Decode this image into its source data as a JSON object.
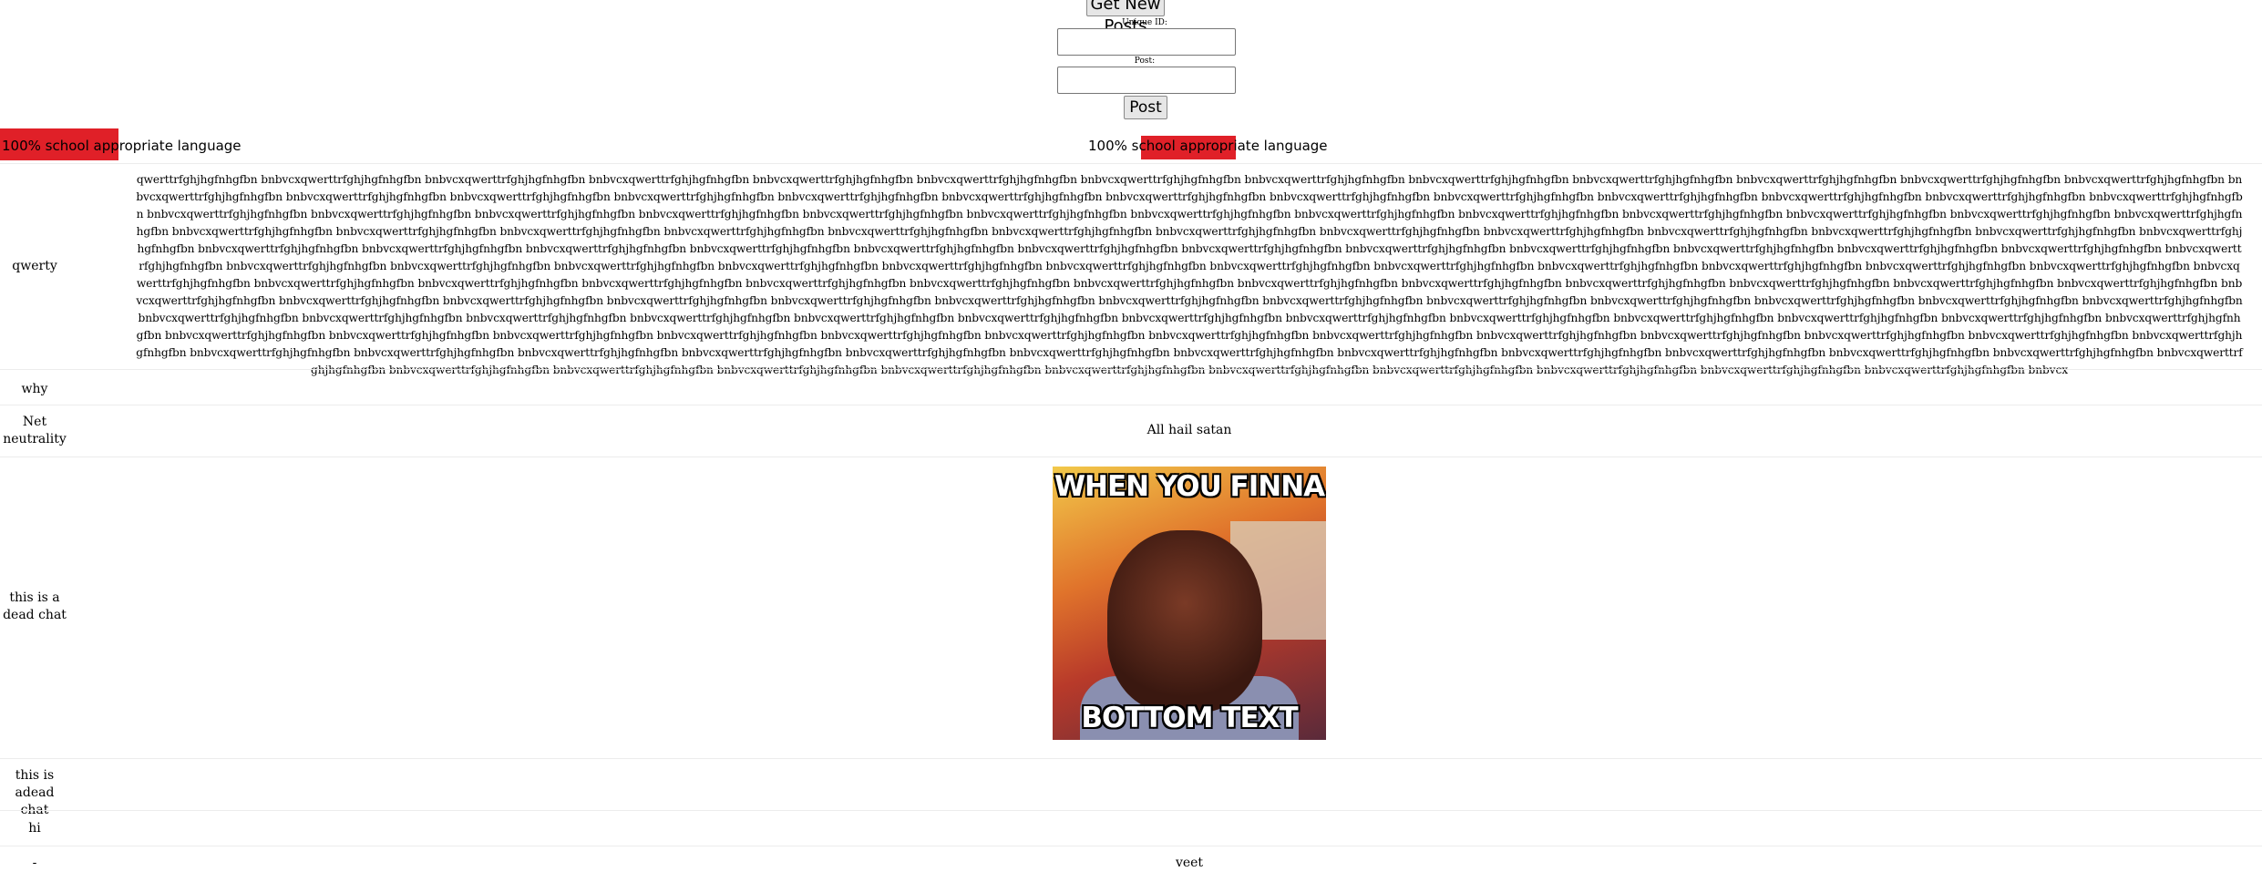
{
  "form": {
    "get_posts_label": "Get New Posts",
    "unique_id_label": "Unique ID:",
    "post_label": "Post:",
    "post_button_label": "Post"
  },
  "banner": {
    "text": "100% school appropriate language"
  },
  "meme": {
    "top_text": "WHEN YOU FINNA",
    "bottom_text": "BOTTOM TEXT"
  },
  "posts": [
    {
      "id": "qwerty",
      "body": "qwerttrfghjhgfnhgfbn bnbvcxqwerttrfghjhgfnhgfbn bnbvcxqwerttrfghjhgfnhgfbn bnbvcxqwerttrfghjhgfnhgfbn bnbvcxqwerttrfghjhgfnhgfbn bnbvcxqwerttrfghjhgfnhgfbn bnbvcxqwerttrfghjhgfnhgfbn bnbvcxqwerttrfghjhgfnhgfbn bnbvcxqwerttrfghjhgfnhgfbn bnbvcxqwerttrfghjhgfnhgfbn bnbvcxqwerttrfghjhgfnhgfbn bnbvcxqwerttrfghjhgfnhgfbn bnbvcxqwerttrfghjhgfnhgfbn bnbvcxqwerttrfghjhgfnhgfbn bnbvcxqwerttrfghjhgfnhgfbn bnbvcxqwerttrfghjhgfnhgfbn bnbvcxqwerttrfghjhgfnhgfbn bnbvcxqwerttrfghjhgfnhgfbn bnbvcxqwerttrfghjhgfnhgfbn bnbvcxqwerttrfghjhgfnhgfbn bnbvcxqwerttrfghjhgfnhgfbn bnbvcxqwerttrfghjhgfnhgfbn bnbvcxqwerttrfghjhgfnhgfbn bnbvcxqwerttrfghjhgfnhgfbn bnbvcxqwerttrfghjhgfnhgfbn bnbvcxqwerttrfghjhgfnhgfbn bnbvcxqwerttrfghjhgfnhgfbn bnbvcxqwerttrfghjhgfnhgfbn bnbvcxqwerttrfghjhgfnhgfbn bnbvcxqwerttrfghjhgfnhgfbn bnbvcxqwerttrfghjhgfnhgfbn bnbvcxqwerttrfghjhgfnhgfbn bnbvcxqwerttrfghjhgfnhgfbn bnbvcxqwerttrfghjhgfnhgfbn bnbvcxqwerttrfghjhgfnhgfbn bnbvcxqwerttrfghjhgfnhgfbn bnbvcxqwerttrfghjhgfnhgfbn bnbvcxqwerttrfghjhgfnhgfbn bnbvcxqwerttrfghjhgfnhgfbn bnbvcxqwerttrfghjhgfnhgfbn bnbvcxqwerttrfghjhgfnhgfbn bnbvcxqwerttrfghjhgfnhgfbn bnbvcxqwerttrfghjhgfnhgfbn bnbvcxqwerttrfghjhgfnhgfbn bnbvcxqwerttrfghjhgfnhgfbn bnbvcxqwerttrfghjhgfnhgfbn bnbvcxqwerttrfghjhgfnhgfbn bnbvcxqwerttrfghjhgfnhgfbn bnbvcxqwerttrfghjhgfnhgfbn bnbvcxqwerttrfghjhgfnhgfbn bnbvcxqwerttrfghjhgfnhgfbn bnbvcxqwerttrfghjhgfnhgfbn bnbvcxqwerttrfghjhgfnhgfbn bnbvcxqwerttrfghjhgfnhgfbn bnbvcxqwerttrfghjhgfnhgfbn bnbvcxqwerttrfghjhgfnhgfbn bnbvcxqwerttrfghjhgfnhgfbn bnbvcxqwerttrfghjhgfnhgfbn bnbvcxqwerttrfghjhgfnhgfbn bnbvcxqwerttrfghjhgfnhgfbn bnbvcxqwerttrfghjhgfnhgfbn bnbvcxqwerttrfghjhgfnhgfbn bnbvcxqwerttrfghjhgfnhgfbn bnbvcxqwerttrfghjhgfnhgfbn bnbvcxqwerttrfghjhgfnhgfbn bnbvcxqwerttrfghjhgfnhgfbn bnbvcxqwerttrfghjhgfnhgfbn bnbvcxqwerttrfghjhgfnhgfbn bnbvcxqwerttrfghjhgfnhgfbn bnbvcxqwerttrfghjhgfnhgfbn bnbvcxqwerttrfghjhgfnhgfbn bnbvcxqwerttrfghjhgfnhgfbn bnbvcxqwerttrfghjhgfnhgfbn bnbvcxqwerttrfghjhgfnhgfbn bnbvcxqwerttrfghjhgfnhgfbn bnbvcxqwerttrfghjhgfnhgfbn bnbvcxqwerttrfghjhgfnhgfbn bnbvcxqwerttrfghjhgfnhgfbn bnbvcxqwerttrfghjhgfnhgfbn bnbvcxqwerttrfghjhgfnhgfbn bnbvcxqwerttrfghjhgfnhgfbn bnbvcxqwerttrfghjhgfnhgfbn bnbvcxqwerttrfghjhgfnhgfbn bnbvcxqwerttrfghjhgfnhgfbn bnbvcxqwerttrfghjhgfnhgfbn bnbvcxqwerttrfghjhgfnhgfbn bnbvcxqwerttrfghjhgfnhgfbn bnbvcxqwerttrfghjhgfnhgfbn bnbvcxqwerttrfghjhgfnhgfbn bnbvcxqwerttrfghjhgfnhgfbn bnbvcxqwerttrfghjhgfnhgfbn bnbvcxqwerttrfghjhgfnhgfbn bnbvcxqwerttrfghjhgfnhgfbn bnbvcxqwerttrfghjhgfnhgfbn bnbvcxqwerttrfghjhgfnhgfbn bnbvcxqwerttrfghjhgfnhgfbn bnbvcxqwerttrfghjhgfnhgfbn bnbvcxqwerttrfghjhgfnhgfbn bnbvcxqwerttrfghjhgfnhgfbn bnbvcxqwerttrfghjhgfnhgfbn bnbvcxqwerttrfghjhgfnhgfbn bnbvcxqwerttrfghjhgfnhgfbn bnbvcxqwerttrfghjhgfnhgfbn bnbvcxqwerttrfghjhgfnhgfbn bnbvcxqwerttrfghjhgfnhgfbn bnbvcxqwerttrfghjhgfnhgfbn bnbvcxqwerttrfghjhgfnhgfbn bnbvcxqwerttrfghjhgfnhgfbn bnbvcxqwerttrfghjhgfnhgfbn bnbvcxqwerttrfghjhgfnhgfbn bnbvcxqwerttrfghjhgfnhgfbn bnbvcxqwerttrfghjhgfnhgfbn bnbvcxqwerttrfghjhgfnhgfbn bnbvcxqwerttrfghjhgfnhgfbn bnbvcxqwerttrfghjhgfnhgfbn bnbvcxqwerttrfghjhgfnhgfbn bnbvcxqwerttrfghjhgfnhgfbn bnbvcxqwerttrfghjhgfnhgfbn bnbvcxqwerttrfghjhgfnhgfbn bnbvcxqwerttrfghjhgfnhgfbn bnbvcxqwerttrfghjhgfnhgfbn bnbvcxqwerttrfghjhgfnhgfbn bnbvcxqwerttrfghjhgfnhgfbn bnbvcxqwerttrfghjhgfnhgfbn bnbvcxqwerttrfghjhgfnhgfbn bnbvcxqwerttrfghjhgfnhgfbn bnbvcxqwerttrfghjhgfnhgfbn bnbvcxqwerttrfghjhgfnhgfbn bnbvcxqwerttrfghjhgfnhgfbn bnbvcxqwerttrfghjhgfnhgfbn bnbvcxqwerttrfghjhgfnhgfbn bnbvcxqwerttrfghjhgfnhgfbn bnbvcxqwerttrfghjhgfnhgfbn bnbvcxqwerttrfghjhgfnhgfbn bnbvcxqwerttrfghjhgfnhgfbn bnbvcxqwerttrfghjhgfnhgfbn bnbvcxqwerttrfghjhgfnhgfbn bnbvcxqwerttrfghjhgfnhgfbn bnbvcxqwerttrfghjhgfnhgfbn bnbvcxqwerttrfghjhgfnhgfbn bnbvcxqwerttrfghjhgfnhgfbn bnbvcxqwerttrfghjhgfnhgfbn bnbvcxqwerttrfghjhgfnhgfbn bnbvcxqwerttrfghjhgfnhgfbn bnbvcxqwerttrfghjhgfnhgfbn bnbvcxqwerttrfghjhgfnhgfbn bnbvcxqwerttrfghjhgfnhgfbn bnbvcxqwerttrfghjhgfnhgfbn bnbvcxqwerttrfghjhgfnhgfbn bnbvcxqwerttrfghjhgfnhgfbn bnbvcxqwerttrfghjhgfnhgfbn bnbvcxqwerttrfghjhgfnhgfbn bnbvcx"
    },
    {
      "id": "why",
      "body": ""
    },
    {
      "id": "Net neutrality",
      "body": "All hail satan"
    },
    {
      "id": "this is a dead chat",
      "body": ""
    },
    {
      "id": "this is adead chat",
      "body": ""
    },
    {
      "id": "hi",
      "body": ""
    },
    {
      "id": "-",
      "body": "veet"
    }
  ],
  "colors": {
    "highlight": "#e02028"
  }
}
